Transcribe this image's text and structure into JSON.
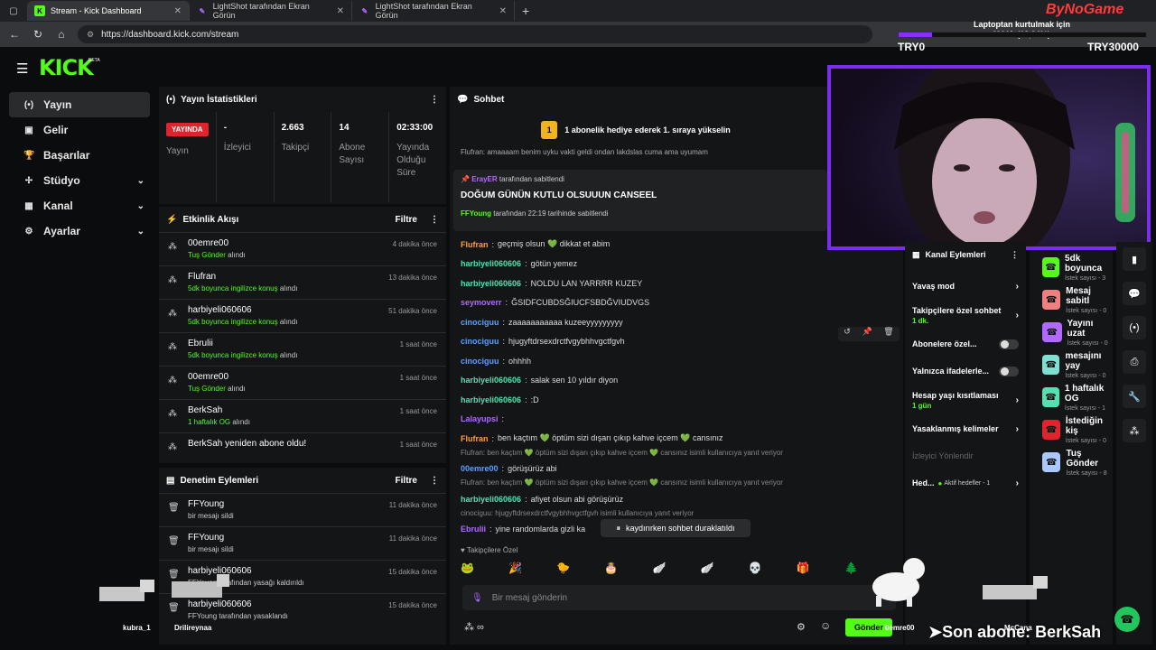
{
  "browser": {
    "tabs": [
      {
        "title": "Stream - Kick Dashboard",
        "active": true,
        "icon": "kick"
      },
      {
        "title": "LightShot tarafından Ekran Görün",
        "active": false,
        "icon": "lightshot"
      },
      {
        "title": "LightShot tarafından Ekran Görün",
        "active": false,
        "icon": "lightshot"
      }
    ],
    "url": "https://dashboard.kick.com/stream"
  },
  "logo": {
    "text": "KICK",
    "beta": "BETA",
    "color": "#53fc18"
  },
  "sidebar": {
    "items": [
      {
        "label": "Yayın",
        "icon": "broadcast-icon",
        "active": true,
        "chevron": false
      },
      {
        "label": "Gelir",
        "icon": "revenue-icon",
        "active": false,
        "chevron": false
      },
      {
        "label": "Başarılar",
        "icon": "trophy-icon",
        "active": false,
        "chevron": false
      },
      {
        "label": "Stüdyo",
        "icon": "studio-icon",
        "active": false,
        "chevron": true
      },
      {
        "label": "Kanal",
        "icon": "channel-icon",
        "active": false,
        "chevron": true
      },
      {
        "label": "Ayarlar",
        "icon": "gear-icon",
        "active": false,
        "chevron": true
      }
    ]
  },
  "stats": {
    "title": "Yayın İstatistikleri",
    "live": "YAYINDA",
    "live_label": "Yayın",
    "viewers_value": "-",
    "viewers_label": "İzleyici",
    "followers_value": "2.663",
    "followers_label": "Takipçi",
    "subs_value": "14",
    "subs_label": "Abone Sayısı",
    "duration_value": "02:33:00",
    "duration_label": "Yayında Olduğu Süre"
  },
  "activity": {
    "title": "Etkinlik Akışı",
    "filter": "Filtre",
    "events": [
      {
        "name": "00emre00",
        "sub_green": "Tuş Gönder",
        "sub_rest": " alındı",
        "time": "4 dakika önce"
      },
      {
        "name": "Flufran",
        "sub_green": "5dk boyunca ingilizce konuş",
        "sub_rest": " alındı",
        "time": "13 dakika önce"
      },
      {
        "name": "harbiyeli060606",
        "sub_green": "5dk boyunca ingilizce konuş",
        "sub_rest": " alındı",
        "time": "51 dakika önce"
      },
      {
        "name": "Ebrulii",
        "sub_green": "5dk boyunca ingilizce konuş",
        "sub_rest": " alındı",
        "time": "1 saat önce"
      },
      {
        "name": "00emre00",
        "sub_green": "Tuş Gönder",
        "sub_rest": " alındı",
        "time": "1 saat önce"
      },
      {
        "name": "BerkSah",
        "sub_green": "1 haftalık OG",
        "sub_rest": " alındı",
        "time": "1 saat önce"
      },
      {
        "name": "BerkSah yeniden abone oldu!",
        "sub_green": "",
        "sub_rest": "",
        "time": "1 saat önce"
      }
    ]
  },
  "moderation": {
    "title": "Denetim Eylemleri",
    "filter": "Filtre",
    "actions": [
      {
        "name": "FFYoung",
        "desc": "bir mesajı sildi",
        "time": "11 dakika önce"
      },
      {
        "name": "FFYoung",
        "desc": "bir mesajı sildi",
        "time": "11 dakika önce"
      },
      {
        "name": "harbiyeli060606",
        "desc": "FFYoung tarafından yasağı kaldırıldı",
        "time": "15 dakika önce"
      },
      {
        "name": "harbiyeli060606",
        "desc": "FFYoung tarafından yasaklandı",
        "time": "15 dakika önce"
      }
    ]
  },
  "chat": {
    "title": "Sohbet",
    "goal": "1 abonelik hediye ederek 1. sıraya yükselin",
    "cutoff": "Flufran: amaaaam benim uyku vakti geldi ondan lakdslas cuma ama uyumam",
    "pinned": {
      "by_user": "ErayER",
      "by_text": " tarafından sabitlendi",
      "message": "DOĞUM GÜNÜN KUTLU OLSUUUN CANSEEL",
      "pin_user": "FFYoung",
      "pin_text": " tarafından 22:19 tarihinde sabitlendi"
    },
    "messages": [
      {
        "user": "Flufran",
        "cls": "u-orange",
        "text": "geçmiş olsun 💚 dikkat et abim"
      },
      {
        "user": "harbiyeli060606",
        "cls": "u-teal",
        "text": "götün yemez"
      },
      {
        "user": "harbiyeli060606",
        "cls": "u-teal",
        "text": "NOLDU LAN YARRRR KUZEY"
      },
      {
        "user": "seymoverr",
        "cls": "u-purple",
        "text": "ĞSIDFCUBDSĞIUCFSBDĞVIUDVGS"
      },
      {
        "user": "cinociguu",
        "cls": "u-blue",
        "text": "zaaaaaaaaaaa kuzeeyyyyyyyyy"
      },
      {
        "user": "cinociguu",
        "cls": "u-blue",
        "text": "hjugyftdrsexdrctfvgybhhvgctfgvh"
      },
      {
        "user": "cinociguu",
        "cls": "u-blue",
        "text": "ohhhh"
      },
      {
        "user": "harbiyeli060606",
        "cls": "u-teal",
        "text": "salak sen 10 yıldır diyon"
      },
      {
        "user": "harbiyeli060606",
        "cls": "u-teal",
        "text": ":D"
      },
      {
        "user": "Lalayupsi",
        "cls": "u-purple",
        "text": ""
      },
      {
        "user": "Flufran",
        "cls": "u-orange",
        "text": "ben kaçtım 💚 öptüm sizi dışarı çıkıp kahve içcem 💚 cansınız"
      }
    ],
    "reply1_quote": "Flufran: ben kaçtım 💚 öptüm sizi dışarı çıkıp kahve içcem 💚 cansınız isimli kullanıcıya yanıt veriyor",
    "reply1_user": "00emre00",
    "reply1_text": "görüşürüz abi",
    "reply2_quote": "Flufran: ben kaçtım 💚 öptüm sizi dışarı çıkıp kahve içcem 💚 cansınız isimli kullanıcıya yanıt veriyor",
    "reply2_user": "harbiyeli060606",
    "reply2_text": "afiyet olsun abi görüşürüz",
    "reply3_quote": "cinociguu: hjugyftdrsexdrctfvgybhhvgctfgvh isimli kullanıcıya yanıt veriyor",
    "reply3_user": "Ebrulii",
    "reply3_text": "yine randomlarda gizli ka",
    "paused": "kaydırırken sohbet duraklatıldı",
    "followers_only": "Takipçilere Özel",
    "input_placeholder": "Bir mesaj gönderin",
    "send": "Gönder"
  },
  "channel_actions": {
    "title": "Kanal Eylemleri",
    "slow_mode": "Yavaş mod",
    "followers_chat": "Takipçilere özel sohbet",
    "followers_chat_sub": "1 dk.",
    "subs_only": "Abonelere özel...",
    "emotes_only": "Yalnızca ifadelerle...",
    "account_age": "Hesap yaşı kısıtlaması",
    "account_age_sub": "1 gün",
    "banned_words": "Yasaklanmış kelimeler",
    "viewer_redirect": "İzleyici Yönlendir",
    "goals": "Hed...",
    "goals_sub": "Aktif hedefler - 1"
  },
  "rewards": [
    {
      "name": "5dk boyunca",
      "sub": "İstek sayısı - 3",
      "color": "#53fc18"
    },
    {
      "name": "Mesaj sabitl",
      "sub": "İstek sayısı - 0",
      "color": "#f08080"
    },
    {
      "name": "Yayını uzat",
      "sub": "İstek sayısı - 0",
      "color": "#b169ff"
    },
    {
      "name": "mesajını yay",
      "sub": "İstek sayısı - 0",
      "color": "#7ee0d0"
    },
    {
      "name": "1 haftalık OG",
      "sub": "İstek sayısı - 1",
      "color": "#4ee3b0"
    },
    {
      "name": "İstediğin kiş",
      "sub": "İstek sayısı - 0",
      "color": "#e0242e"
    },
    {
      "name": "Tuş Gönder",
      "sub": "İstek sayısı - 8",
      "color": "#aac8ff"
    }
  ],
  "overlay": {
    "brand": "ByNoGame",
    "goal_text": "Laptoptan kurtulmak için",
    "goal_progress": "4001₺ (13,34%)",
    "progress_fraction": 0.1334,
    "left_team": "TRY0",
    "right_team": "TRY30000",
    "last_sub": "➤Son abone: BerkSah",
    "cat_names": [
      "kubra_1",
      "Drilireynaa",
      "0emre00",
      "McCana"
    ]
  }
}
